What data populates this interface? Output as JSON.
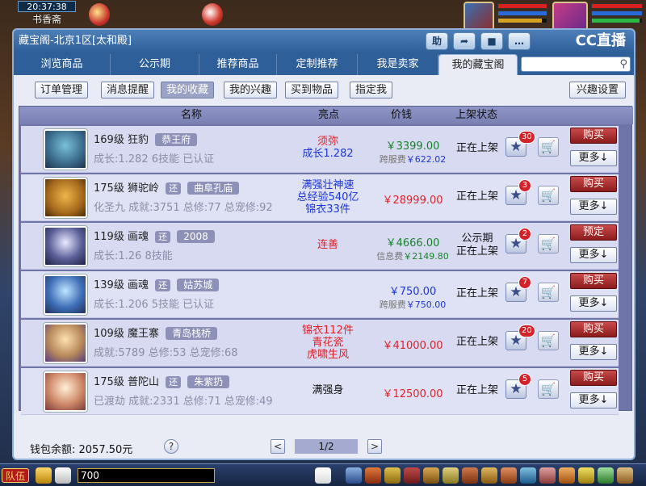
{
  "hud": {
    "time": "20:37:38",
    "location": "书香斋"
  },
  "window": {
    "title": "藏宝阁-北京1区[太和殿]",
    "title_buttons": [
      "助",
      "➦",
      "■",
      "…"
    ],
    "brand": "CC直播"
  },
  "tabs": [
    "浏览商品",
    "公示期",
    "推荐商品",
    "定制推荐",
    "我是卖家",
    "我的藏宝阁"
  ],
  "active_tab": "我的藏宝阁",
  "search": {
    "placeholder": ""
  },
  "subtabs": [
    "订单管理",
    "消息提醒",
    "我的收藏",
    "我的兴趣",
    "买到物品",
    "指定我"
  ],
  "active_subtab": "我的收藏",
  "interest_button": "兴趣设置",
  "table_headers": {
    "name": "名称",
    "highlight": "亮点",
    "price": "价钱",
    "status": "上架状态"
  },
  "rows": [
    {
      "level": "169级",
      "name": "狂豹",
      "tag": "恭王府",
      "tag_prefix": "",
      "stats": "成长:1.282 6技能 已认证",
      "highlights": [
        {
          "text": "须弥",
          "color": "red"
        },
        {
          "text": "成长1.282",
          "color": "blue"
        }
      ],
      "price": "￥3399.00",
      "price_color": "green",
      "fee_label": "跨服费",
      "fee": "￥622.02",
      "status": [
        "正在上架"
      ],
      "fav_count": "30",
      "action": "购买",
      "more": "更多↓"
    },
    {
      "level": "175级",
      "name": "狮驼岭",
      "tag": "曲阜孔庙",
      "tag_prefix": "还",
      "stats": "化圣九 成就:3751 总修:77 总宠修:92",
      "highlights": [
        {
          "text": "满强壮神速",
          "color": "blue"
        },
        {
          "text": "总经验540亿",
          "color": "blue"
        },
        {
          "text": "锦衣33件",
          "color": "blue"
        }
      ],
      "price": "￥28999.00",
      "price_color": "red",
      "fee_label": "",
      "fee": "",
      "status": [
        "正在上架"
      ],
      "fav_count": "3",
      "action": "购买",
      "more": "更多↓"
    },
    {
      "level": "119级",
      "name": "画魂",
      "tag": "2008",
      "tag_prefix": "还",
      "stats": "成长:1.26 8技能",
      "highlights": [
        {
          "text": "连善",
          "color": "red"
        }
      ],
      "price": "￥4666.00",
      "price_color": "green",
      "fee_label": "信息费",
      "fee": "￥2149.80",
      "status": [
        "公示期",
        "正在上架"
      ],
      "fav_count": "2",
      "action": "预定",
      "more": "更多↓"
    },
    {
      "level": "139级",
      "name": "画魂",
      "tag": "姑苏城",
      "tag_prefix": "还",
      "stats": "成长:1.206 5技能 已认证",
      "highlights": [],
      "price": "￥750.00",
      "price_color": "blue",
      "fee_label": "跨服费",
      "fee": "￥750.00",
      "status": [
        "正在上架"
      ],
      "fav_count": "7",
      "action": "购买",
      "more": "更多↓"
    },
    {
      "level": "109级",
      "name": "魔王寨",
      "tag": "青岛栈桥",
      "tag_prefix": "",
      "stats": "成就:5789 总修:53 总宠修:68",
      "highlights": [
        {
          "text": "锦衣112件",
          "color": "red"
        },
        {
          "text": "青花瓷",
          "color": "red"
        },
        {
          "text": "虎啸生风",
          "color": "red"
        }
      ],
      "price": "￥41000.00",
      "price_color": "red",
      "fee_label": "",
      "fee": "",
      "status": [
        "正在上架"
      ],
      "fav_count": "20",
      "action": "购买",
      "more": "更多↓"
    },
    {
      "level": "175级",
      "name": "普陀山",
      "tag": "朱紫扔",
      "tag_prefix": "还",
      "stats": "已渡劫 成就:2331 总修:71 总宠修:49",
      "highlights": [
        {
          "text": "满强身",
          "color": "black"
        }
      ],
      "price": "￥12500.00",
      "price_color": "red",
      "fee_label": "",
      "fee": "",
      "status": [
        "正在上架"
      ],
      "fav_count": "5",
      "action": "购买",
      "more": "更多↓"
    }
  ],
  "footer": {
    "wallet": "钱包余额: 2057.50元",
    "help": "?",
    "page": "1/2",
    "prev": "<",
    "next": ">"
  },
  "chat": {
    "team": "队伍",
    "input_value": "700"
  }
}
